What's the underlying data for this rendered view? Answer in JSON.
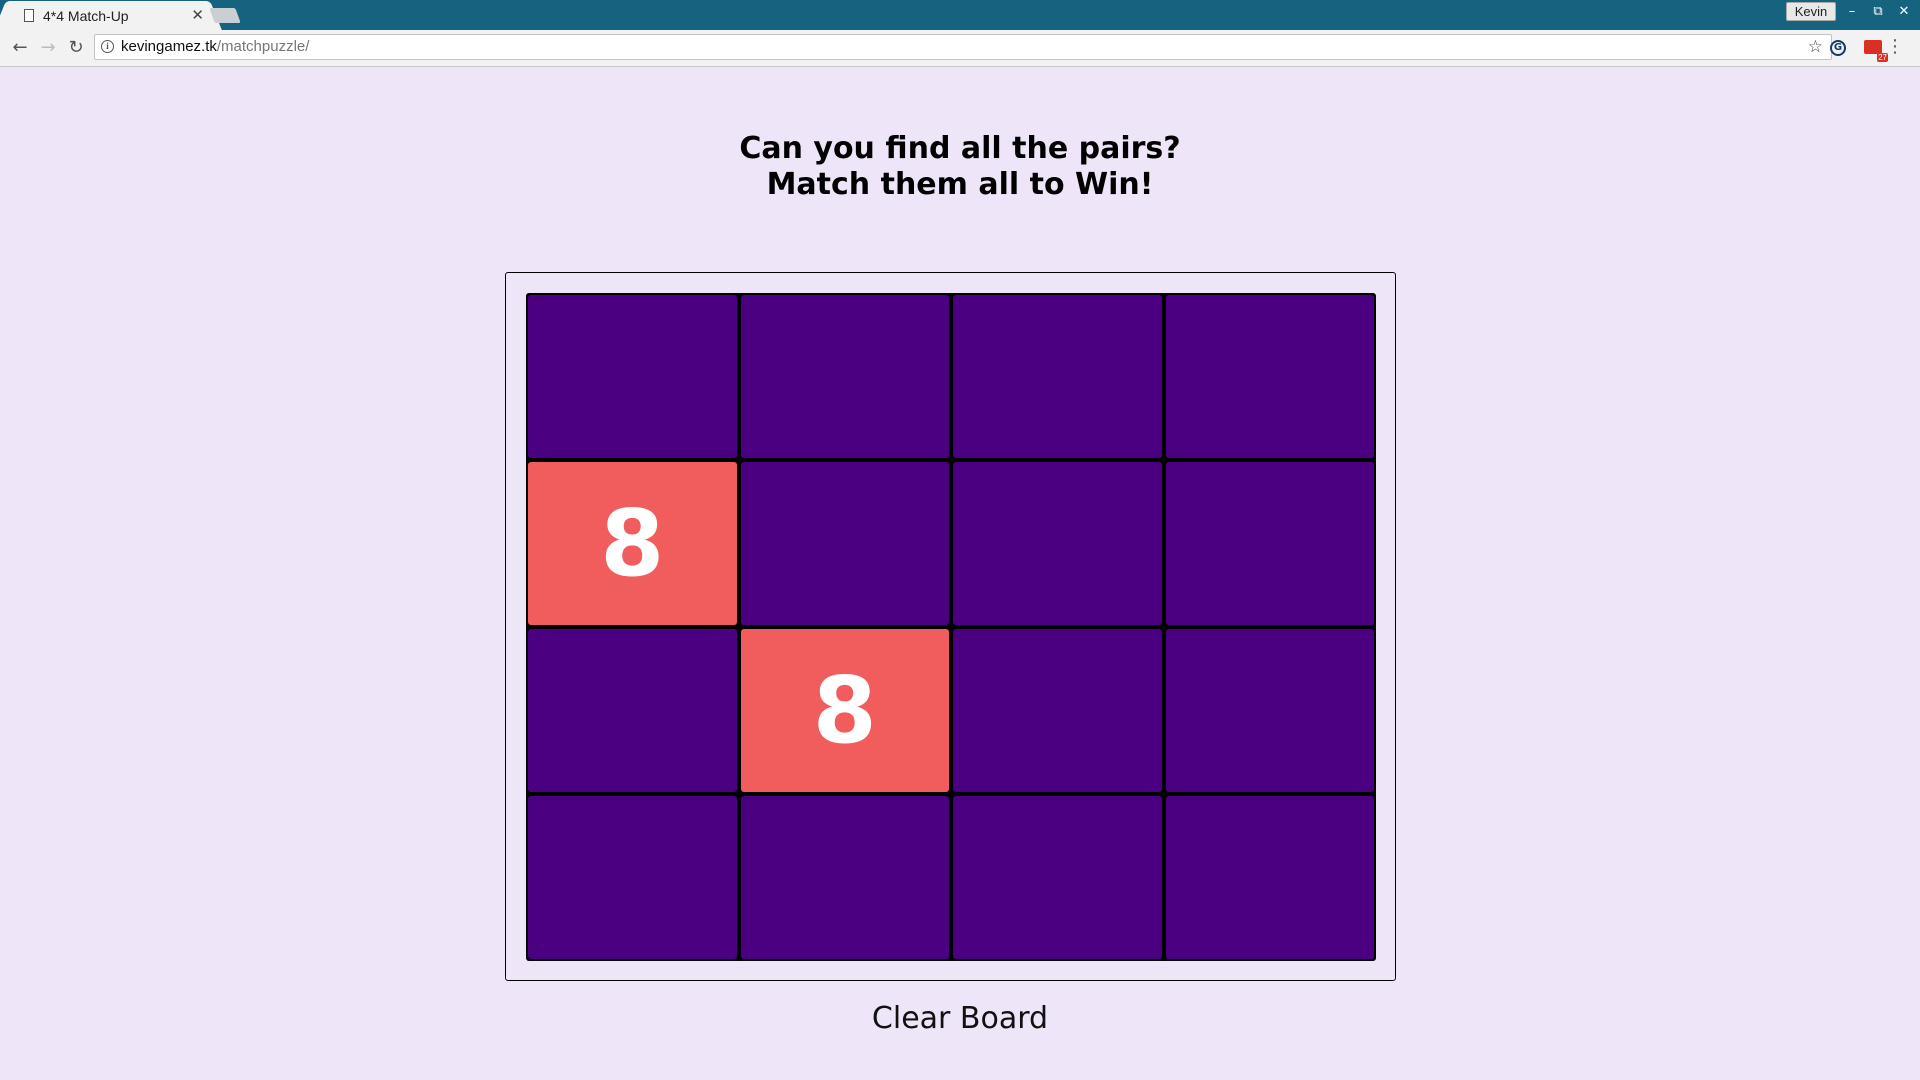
{
  "browser": {
    "tab_title": "4*4 Match-Up",
    "tab_close": "✕",
    "profile_name": "Kevin",
    "url_host": "kevingamez.tk",
    "url_path": "/matchpuzzle/",
    "window_controls": {
      "minimize": "–",
      "restore": "⧉",
      "close": "✕"
    },
    "nav": {
      "back": "←",
      "forward": "→",
      "reload": "↻"
    },
    "icons": {
      "info": "i",
      "star": "☆",
      "grammarly": "G",
      "gmail_badge": "27",
      "menu": "⋮"
    }
  },
  "page": {
    "heading_line1": "Can you find all the pairs?",
    "heading_line2": "Match them all to Win!",
    "clear_button": "Clear Board",
    "colors": {
      "background": "#efe5f8",
      "hidden_tile": "#4b0082",
      "revealed_tile": "#f15c5c"
    }
  },
  "board": {
    "rows": 4,
    "cols": 4,
    "tiles": [
      {
        "label": ""
      },
      {
        "label": ""
      },
      {
        "label": ""
      },
      {
        "label": ""
      },
      {
        "label": "8",
        "revealed": true
      },
      {
        "label": ""
      },
      {
        "label": ""
      },
      {
        "label": ""
      },
      {
        "label": ""
      },
      {
        "label": "8",
        "revealed": true
      },
      {
        "label": ""
      },
      {
        "label": ""
      },
      {
        "label": ""
      },
      {
        "label": ""
      },
      {
        "label": ""
      },
      {
        "label": ""
      }
    ]
  }
}
